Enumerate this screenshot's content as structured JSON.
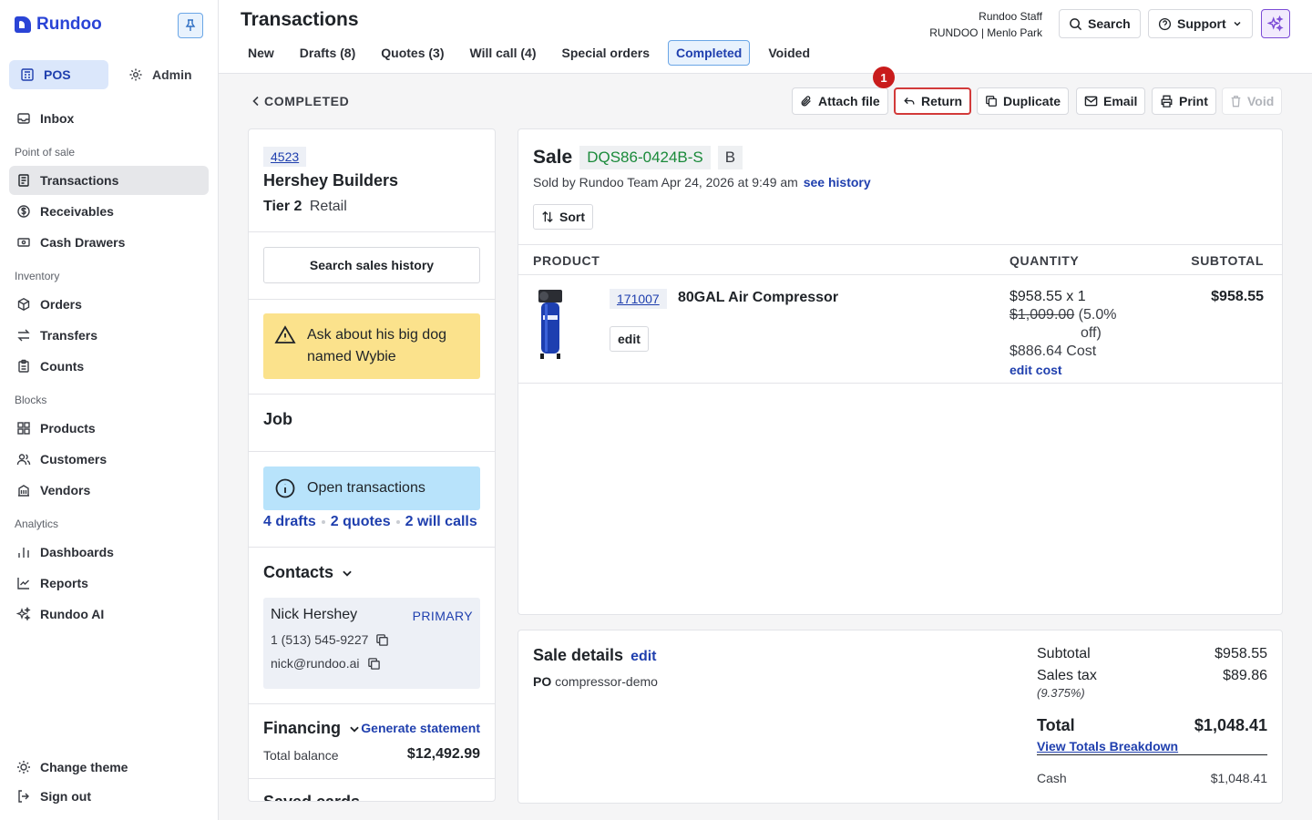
{
  "brand": "Rundoo",
  "modes": {
    "pos": "POS",
    "admin": "Admin"
  },
  "nav": {
    "inbox": "Inbox",
    "sections": {
      "pos": "Point of sale",
      "inventory": "Inventory",
      "blocks": "Blocks",
      "analytics": "Analytics"
    },
    "transactions": "Transactions",
    "receivables": "Receivables",
    "cash_drawers": "Cash Drawers",
    "orders": "Orders",
    "transfers": "Transfers",
    "counts": "Counts",
    "products": "Products",
    "customers": "Customers",
    "vendors": "Vendors",
    "dashboards": "Dashboards",
    "reports": "Reports",
    "rundoo_ai": "Rundoo AI",
    "change_theme": "Change theme",
    "sign_out": "Sign out"
  },
  "header": {
    "title": "Transactions",
    "tabs": [
      "New",
      "Drafts (8)",
      "Quotes (3)",
      "Will call (4)",
      "Special orders",
      "Completed",
      "Voided"
    ],
    "active_tab": "Completed",
    "user_name": "Rundoo Staff",
    "store": "RUNDOO | Menlo Park",
    "search": "Search",
    "support": "Support"
  },
  "breadcrumb": "COMPLETED",
  "actions": {
    "attach": "Attach file",
    "return": "Return",
    "duplicate": "Duplicate",
    "email": "Email",
    "print": "Print",
    "void": "Void",
    "badge": "1"
  },
  "customer": {
    "id": "4523",
    "name": "Hershey Builders",
    "tier": "Tier 2",
    "type": "Retail",
    "search_history": "Search sales history",
    "note": "Ask about his big dog named Wybie",
    "job_title": "Job",
    "open_transactions": "Open transactions",
    "links": {
      "drafts": "4 drafts",
      "quotes": "2 quotes",
      "will_calls": "2 will calls"
    },
    "contacts_title": "Contacts",
    "contact": {
      "name": "Nick Hershey",
      "role": "PRIMARY",
      "phone": "1 (513) 545-9227",
      "email": "nick@rundoo.ai"
    },
    "financing_title": "Financing",
    "generate_statement": "Generate statement",
    "total_balance_label": "Total balance",
    "total_balance": "$12,492.99",
    "saved_cards": "Saved cards"
  },
  "sale": {
    "label": "Sale",
    "id": "DQS86-0424B-S",
    "tag": "B",
    "sold_by": "Sold by Rundoo Team Apr 24, 2026 at 9:49 am",
    "see_history": "see history",
    "sort": "Sort",
    "columns": {
      "product": "PRODUCT",
      "quantity": "QUANTITY",
      "subtotal": "SUBTOTAL"
    },
    "line": {
      "sku": "171007",
      "name": "80GAL Air Compressor",
      "edit": "edit",
      "price_qty": "$958.55 x 1",
      "orig_price": "$1,009.00",
      "discount_a": "(5.0%",
      "discount_b": "off)",
      "cost": "$886.64 Cost",
      "edit_cost": "edit cost",
      "subtotal": "$958.55"
    }
  },
  "details": {
    "title": "Sale details",
    "edit": "edit",
    "po_label": "PO",
    "po_value": "compressor-demo",
    "subtotal_label": "Subtotal",
    "subtotal": "$958.55",
    "tax_label": "Sales tax",
    "tax": "$89.86",
    "tax_rate": "(9.375%)",
    "total_label": "Total",
    "total": "$1,048.41",
    "breakdown": "View Totals Breakdown",
    "cash_label": "Cash",
    "cash": "$1,048.41"
  }
}
